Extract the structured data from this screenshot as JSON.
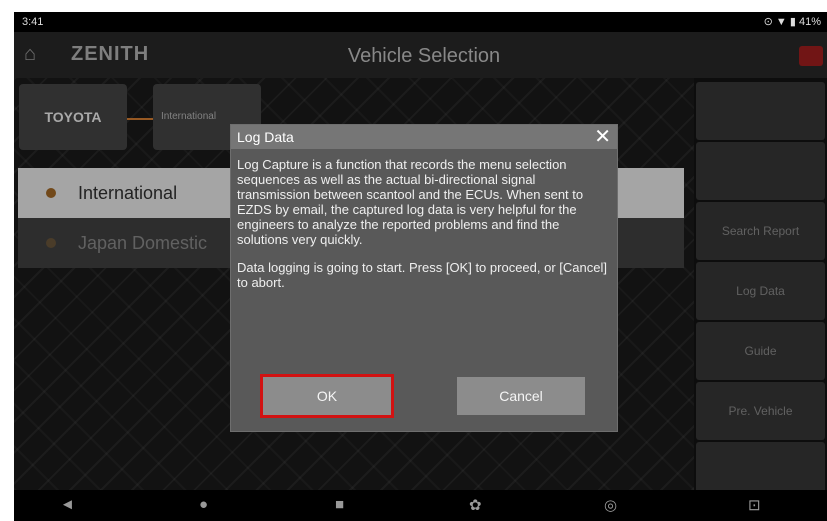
{
  "status": {
    "time": "3:41",
    "icons_right": "⊙ ▼ ▮ 41%"
  },
  "appbar": {
    "logo": "ZENITH",
    "title": "Vehicle Selection"
  },
  "brand": {
    "name": "TOYOTA",
    "region": "International"
  },
  "regions": [
    "International",
    "Japan Domestic"
  ],
  "sidebar": [
    "",
    "",
    "Search Report",
    "Log Data",
    "Guide",
    "Pre. Vehicle",
    ""
  ],
  "dialog": {
    "title": "Log Data",
    "body1": "Log Capture is a function that records the menu selection sequences as well as the actual bi-directional signal transmission between scantool and the ECUs. When sent to EZDS by email, the captured log data is very helpful for the engineers to analyze the reported problems and find the solutions very quickly.",
    "body2": "Data logging is going to start. Press [OK] to proceed, or [Cancel] to abort.",
    "ok": "OK",
    "cancel": "Cancel"
  },
  "navbar": {
    "back_icon": "◄",
    "home_icon": "●",
    "recents_icon": "■",
    "settings_icon": "✿",
    "chrome_icon": "◎",
    "screenshot_icon": "⊡"
  },
  "colors": {
    "dialog_bg": "#595959",
    "ok_highlight": "#d21212",
    "active_item": "#cacaca",
    "accent": "#b96d2b"
  }
}
